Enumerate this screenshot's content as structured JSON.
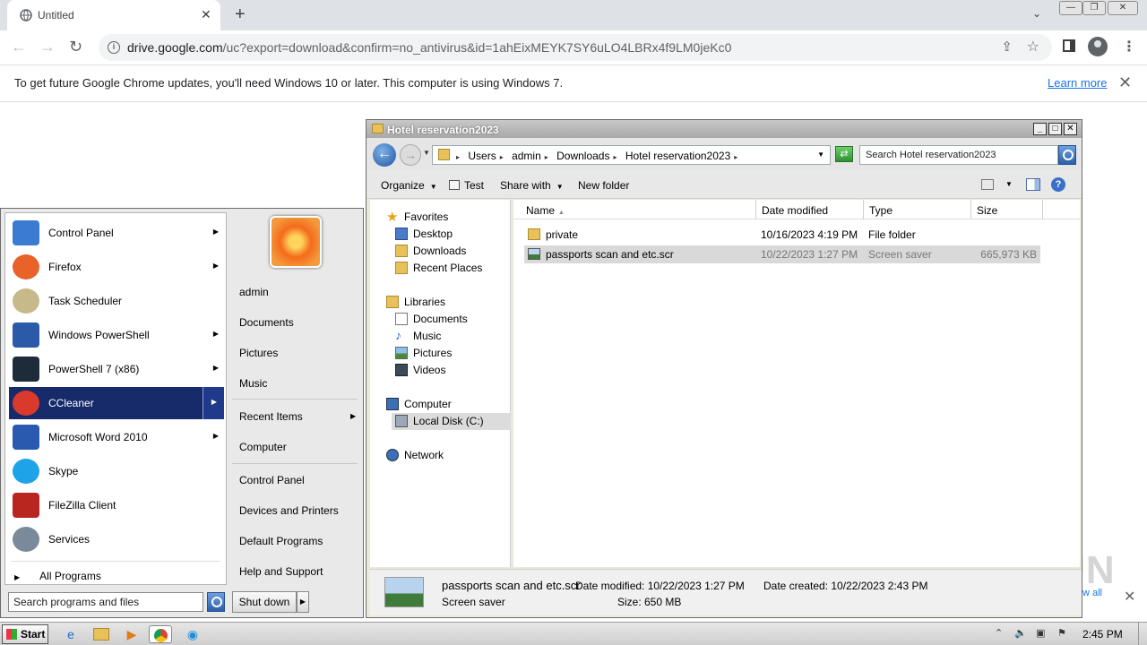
{
  "chrome": {
    "tab_title": "Untitled",
    "tab_close": "✕",
    "new_tab": "+",
    "tab_search": "⌄",
    "window_min": "—",
    "window_max": "❐",
    "window_close": "✕",
    "back": "←",
    "forward": "→",
    "reload": "↻",
    "url_host": "drive.google.com",
    "url_path": "/uc?export=download&confirm=no_antivirus&id=1ahEixMEYK7SY6uLO4LBRx4f9LM0jeKc0",
    "share": "⇪",
    "star": "☆",
    "menu": "⋮",
    "infobar_message": "To get future Google Chrome updates, you'll need Windows 10 or later. This computer is using Windows 7.",
    "infobar_link": "Learn more",
    "infobar_close": "✕"
  },
  "explorer": {
    "title": "Hotel reservation2023",
    "breadcrumbs": [
      "Users",
      "admin",
      "Downloads",
      "Hotel reservation2023"
    ],
    "search_placeholder": "Search Hotel reservation2023",
    "commands": {
      "organize": "Organize",
      "test": "Test",
      "share_with": "Share with",
      "new_folder": "New folder"
    },
    "nav": {
      "favorites": "Favorites",
      "desktop": "Desktop",
      "downloads": "Downloads",
      "recent_places": "Recent Places",
      "libraries": "Libraries",
      "documents": "Documents",
      "music": "Music",
      "pictures": "Pictures",
      "videos": "Videos",
      "computer": "Computer",
      "local_disk": "Local Disk (C:)",
      "network": "Network"
    },
    "columns": {
      "name": "Name",
      "date_modified": "Date modified",
      "type": "Type",
      "size": "Size"
    },
    "files": [
      {
        "name": "private",
        "date": "10/16/2023 4:19 PM",
        "type": "File folder",
        "size": ""
      },
      {
        "name": "passports scan and etc.scr",
        "date": "10/22/2023 1:27 PM",
        "type": "Screen saver",
        "size": "665,973 KB"
      }
    ],
    "details": {
      "name": "passports scan and etc.scr",
      "type": "Screen saver",
      "date_modified": "Date modified: 10/22/2023 1:27 PM",
      "size": "Size: 650 MB",
      "date_created": "Date created: 10/22/2023 2:43 PM"
    }
  },
  "start_menu": {
    "programs": [
      {
        "label": "Control Panel",
        "icon": "control-panel-icon",
        "color": "#3b7bd1"
      },
      {
        "label": "Firefox",
        "icon": "firefox-icon",
        "color": "#e8622a"
      },
      {
        "label": "Task Scheduler",
        "icon": "task-scheduler-icon",
        "color": "#c8b98a"
      },
      {
        "label": "Windows PowerShell",
        "icon": "powershell-icon",
        "color": "#2a5aa8"
      },
      {
        "label": "PowerShell 7 (x86)",
        "icon": "powershell7-icon",
        "color": "#1d2b3a"
      },
      {
        "label": "CCleaner",
        "icon": "ccleaner-icon",
        "color": "#d93a2b"
      },
      {
        "label": "Microsoft Word 2010",
        "icon": "word-icon",
        "color": "#2a5ab0"
      },
      {
        "label": "Skype",
        "icon": "skype-icon",
        "color": "#1fa3e8"
      },
      {
        "label": "FileZilla Client",
        "icon": "filezilla-icon",
        "color": "#b8261f"
      },
      {
        "label": "Services",
        "icon": "services-icon",
        "color": "#7a8a9a"
      }
    ],
    "all_programs": "All Programs",
    "search_placeholder": "Search programs and files",
    "places": {
      "user": "admin",
      "documents": "Documents",
      "pictures": "Pictures",
      "music": "Music",
      "recent_items": "Recent Items",
      "computer": "Computer",
      "control_panel": "Control Panel",
      "devices_printers": "Devices and Printers",
      "default_programs": "Default Programs",
      "help_support": "Help and Support"
    },
    "shutdown": "Shut down"
  },
  "background": {
    "watermark": "ANY RUN",
    "download_show_all": "w all",
    "download_close": "✕"
  },
  "taskbar": {
    "start": "Start",
    "clock": "2:45 PM"
  }
}
